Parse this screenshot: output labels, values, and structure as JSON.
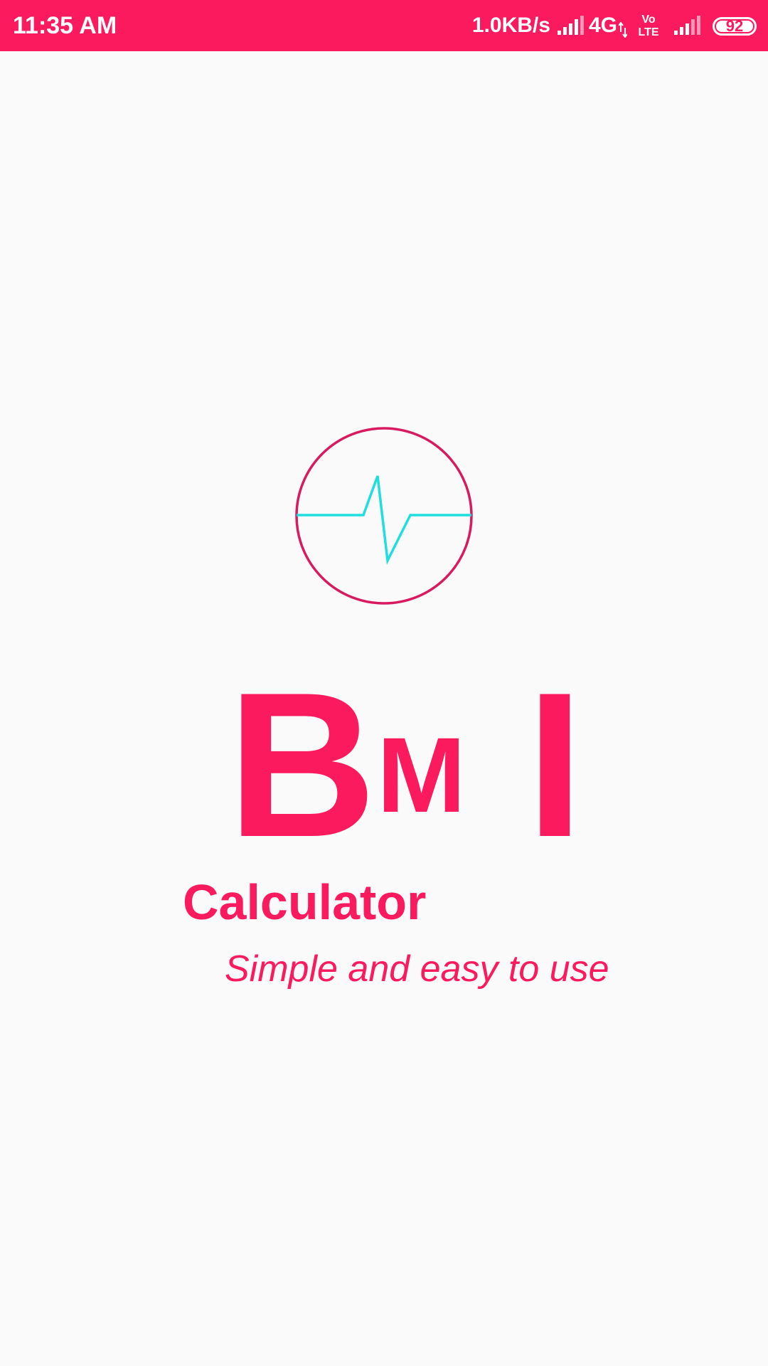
{
  "status_bar": {
    "time": "11:35 AM",
    "net_speed": "1.0KB/s",
    "network_type": "4G",
    "volte_label_top": "Vo",
    "volte_label_bottom": "LTE",
    "battery_level": "92",
    "icons": [
      "signal-icon",
      "data-arrows-icon",
      "volte-icon",
      "signal-icon",
      "battery-icon"
    ],
    "color": "#fc1a5f"
  },
  "splash": {
    "logo_icon": "heartbeat-circle-icon",
    "title_letters": [
      "B",
      "M",
      "I"
    ],
    "subtitle": "Calculator",
    "tagline": "Simple and easy to use",
    "accent_color": "#fc1a5f",
    "pulse_color": "#1fdede",
    "ring_color": "#d81b60"
  }
}
